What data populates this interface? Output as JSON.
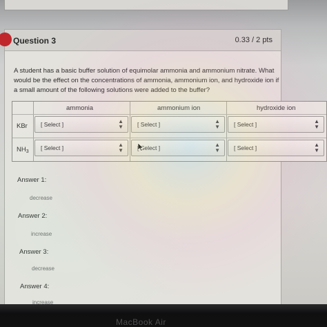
{
  "question": {
    "title": "Question 3",
    "points": "0.33 / 2 pts",
    "text": "A student has a basic buffer solution of equimolar ammonia and ammonium nitrate. What would be the effect on the concentrations of ammonia, ammonium ion, and hydroxide ion if a small amount of the following solutions were added to the buffer?"
  },
  "table": {
    "columns": [
      "ammonia",
      "ammonium ion",
      "hydroxide ion"
    ],
    "rows": [
      {
        "label": "KBr",
        "selects": [
          "[ Select ]",
          "[ Select ]",
          "[ Select ]"
        ]
      },
      {
        "label_main": "NH",
        "label_sub": "3",
        "selects": [
          "[ Select ]",
          "[ Select ]",
          "[ Select ]"
        ]
      }
    ]
  },
  "answers": [
    {
      "label": "Answer 1:",
      "value": "decrease"
    },
    {
      "label": "Answer 2:",
      "value": "increase"
    },
    {
      "label": "Answer 3:",
      "value": "decrease"
    },
    {
      "label": "Answer 4:",
      "value": "increase"
    }
  ],
  "device": {
    "bezel_label": "MacBook Air"
  },
  "colors": {
    "accent_red": "#c0272d",
    "bezel": "#111111"
  }
}
